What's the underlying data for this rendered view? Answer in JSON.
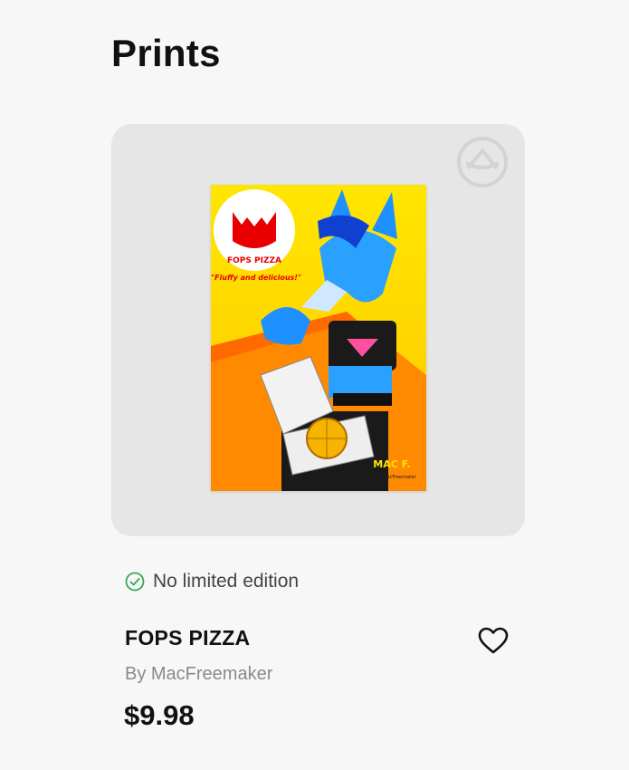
{
  "page": {
    "title": "Prints"
  },
  "product_card": {
    "badge_icon": "brand-logo-icon",
    "artwork": {
      "logo_text": "FOPS PIZZA",
      "tagline": "\"Fluffy and delicious!\"",
      "signature": "MAC F.",
      "signature_handle": "@MacFreemaker"
    }
  },
  "edition": {
    "icon": "check-circle-icon",
    "label": "No limited edition",
    "color": "#3aa655"
  },
  "product": {
    "title": "FOPS PIZZA",
    "artist": "By MacFreemaker",
    "price": "$9.98",
    "favorite_icon": "heart-icon"
  }
}
